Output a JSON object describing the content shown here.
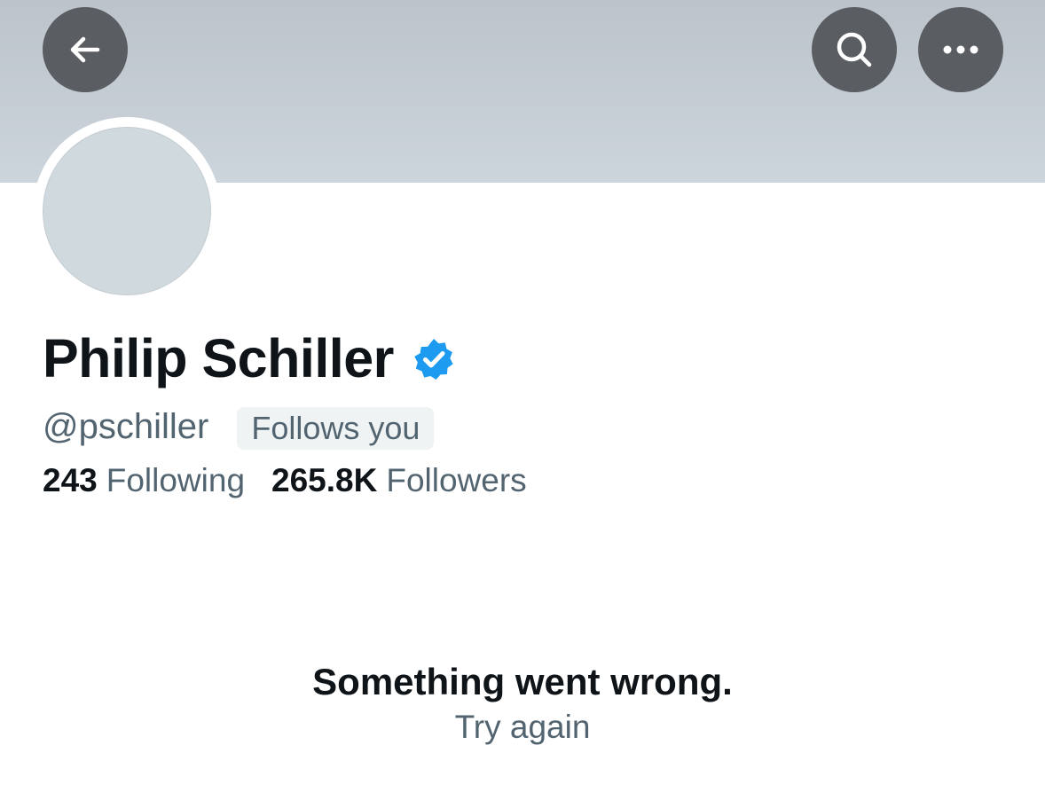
{
  "profile": {
    "display_name": "Philip Schiller",
    "handle": "@pschiller",
    "follows_you_label": "Follows you",
    "verified": true
  },
  "stats": {
    "following_count": "243",
    "following_label": "Following",
    "followers_count": "265.8K",
    "followers_label": "Followers"
  },
  "error": {
    "title": "Something went wrong.",
    "retry_label": "Try again"
  },
  "icons": {
    "back": "arrow-left-icon",
    "search": "search-icon",
    "more": "more-horizontal-icon",
    "verified": "verified-badge-icon"
  },
  "colors": {
    "banner": "#c5ccd3",
    "nav_button": "#5a5e63",
    "verified_blue": "#1d9bf0",
    "primary_text": "#0f1419",
    "secondary_text": "#536471",
    "badge_bg": "#eff3f4"
  }
}
